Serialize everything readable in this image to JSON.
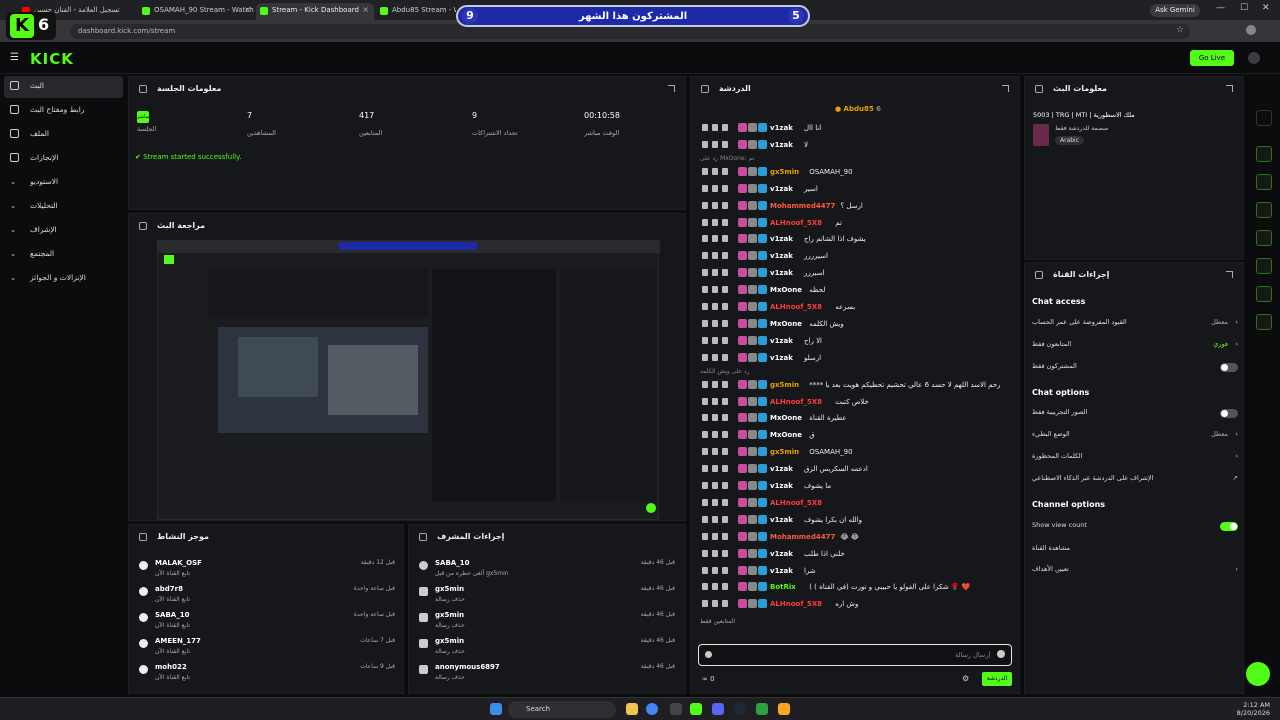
{
  "browser": {
    "tabs": [
      {
        "title": "تسجيل العلامة - الفنان حسين"
      },
      {
        "title": "OSAMAH_90 Stream - Watch Li"
      },
      {
        "title": "Stream - Kick Dashboard"
      },
      {
        "title": "Abdu85 Stream - Watch"
      }
    ],
    "url": "dashboard.kick.com/stream",
    "ask_gemini": "Ask Gemini"
  },
  "overlay": {
    "logo_number": "6",
    "sub_banner_text": "المشتركون هذا الشهر",
    "sub_left_count": "9",
    "sub_right_count": "5"
  },
  "header": {
    "logo": "KICK",
    "go_live": "Go Live"
  },
  "sidebar": {
    "items": [
      {
        "label": "البث"
      },
      {
        "label": "رابط ومفتاح البث"
      },
      {
        "label": "الملف"
      },
      {
        "label": "الإنجازات"
      },
      {
        "label": "الاستوديو"
      },
      {
        "label": "التحليلات"
      },
      {
        "label": "الإشراف"
      },
      {
        "label": "المجتمع"
      },
      {
        "label": "الإنزالات و الجوائز"
      }
    ]
  },
  "session": {
    "title": "معلومات الجلسة",
    "live_badge": "مباشر",
    "session_label": "الجلسة",
    "viewers": "7",
    "viewers_label": "المشاهدين",
    "followers": "417",
    "followers_label": "المتابعين",
    "subs": "9",
    "subs_label": "تحداد الاشتراكات",
    "uptime": "00:10:58",
    "uptime_label": "الوقت مباشر",
    "status": "Stream started successfully."
  },
  "preview": {
    "title": "مراجعة البث"
  },
  "activity": {
    "title": "موجز النشاط",
    "items": [
      {
        "name": "MALAK_OSF",
        "desc": "تابع القناة الآن",
        "time": "قبل 12 دقيقة"
      },
      {
        "name": "abd7r8",
        "desc": "تابع القناة الآن",
        "time": "قبل ساعة واحدة"
      },
      {
        "name": "SABA_10",
        "desc": "تابع القناة الآن",
        "time": "قبل ساعة واحدة"
      },
      {
        "name": "AMEEN_177",
        "desc": "تابع القناة الآن",
        "time": "قبل 7 ساعات"
      },
      {
        "name": "moh022",
        "desc": "تابع القناة الآن",
        "time": "قبل 9 ساعات"
      }
    ]
  },
  "modactions": {
    "title": "إجراءات المشرف",
    "items": [
      {
        "name": "SABA_10",
        "desc": "ألغى حظره من قبل gx5min",
        "time": "قبل 46 دقيقة"
      },
      {
        "name": "gx5min",
        "desc": "حذف رسالة",
        "time": "قبل 46 دقيقة"
      },
      {
        "name": "gx5min",
        "desc": "حذف رسالة",
        "time": "قبل 46 دقيقة"
      },
      {
        "name": "gx5min",
        "desc": "حذف رسالة",
        "time": "قبل 46 دقيقة"
      },
      {
        "name": "anonymous6897",
        "desc": "حذف رسالة",
        "time": "قبل 46 دقيقة"
      }
    ]
  },
  "chat": {
    "title": "الدردشة",
    "pinned_user": "Abdu85",
    "pinned_count": "6",
    "messages": [
      {
        "user": "v1zak",
        "color": "#ffffff",
        "text": "انا اال"
      },
      {
        "user": "v1zak",
        "color": "#ffffff",
        "text": "لا"
      },
      {
        "reply": "رد على MxOone: تم"
      },
      {
        "user": "gx5min",
        "color": "#e9a000",
        "text": "OSAMAH_90"
      },
      {
        "user": "v1zak",
        "color": "#ffffff",
        "text": "اسير"
      },
      {
        "user": "Mohammed4477",
        "color": "#ff5a3c",
        "text": "ارسل ؟"
      },
      {
        "user": "ALHnoof_5X8",
        "color": "#ff3b3b",
        "text": "تم"
      },
      {
        "user": "v1zak",
        "color": "#ffffff",
        "text": "يشوف اذا الشاتم راح"
      },
      {
        "user": "v1zak",
        "color": "#ffffff",
        "text": "اسيرررر"
      },
      {
        "user": "v1zak",
        "color": "#ffffff",
        "text": "اسيررر"
      },
      {
        "user": "MxOone",
        "color": "#ffffff",
        "text": "لحظه"
      },
      {
        "user": "ALHnoof_5X8",
        "color": "#ff3b3b",
        "text": "بسرعه"
      },
      {
        "user": "MxOone",
        "color": "#ffffff",
        "text": "ويش الكلمه"
      },
      {
        "user": "v1zak",
        "color": "#ffffff",
        "text": "الا راح"
      },
      {
        "user": "v1zak",
        "color": "#ffffff",
        "text": "ارسلو"
      },
      {
        "reply": "رد على ويش الكلمه"
      },
      {
        "user": "gx5min",
        "color": "#e9a000",
        "text": "**** رحم الاسد اللهم لا حسد 6 عالي تحشيم تحطيكم هويت بعد يا"
      },
      {
        "user": "ALHnoof_5X8",
        "color": "#ff3b3b",
        "text": "خلاص كتبت"
      },
      {
        "user": "MxOone",
        "color": "#ffffff",
        "text": "عطيرة القناة"
      },
      {
        "user": "MxOone",
        "color": "#ffffff",
        "text": "ق"
      },
      {
        "user": "gx5min",
        "color": "#e9a000",
        "text": "OSAMAH_90"
      },
      {
        "user": "v1zak",
        "color": "#ffffff",
        "text": "ادعمه السكربس الزق"
      },
      {
        "user": "v1zak",
        "color": "#ffffff",
        "text": "ما يشوف"
      },
      {
        "user": "ALHnoof_5X8",
        "color": "#ff3b3b",
        "text": ""
      },
      {
        "user": "v1zak",
        "color": "#ffffff",
        "text": "والله ان بكرا يشوف"
      },
      {
        "user": "Mohammed4477",
        "color": "#ff5a3c",
        "text": "😂 😂"
      },
      {
        "user": "v1zak",
        "color": "#ffffff",
        "text": "خلني اذا طلب"
      },
      {
        "user": "v1zak",
        "color": "#ffffff",
        "text": "شرا"
      },
      {
        "user": "BotRix",
        "color": "#53fc18",
        "text": "( شكرا على الفولو يا حبيبي و نورت (في القناة ) 🌹 ❤️"
      },
      {
        "user": "ALHnoof_5X8",
        "color": "#ff3b3b",
        "text": "وش اره"
      }
    ],
    "followers_only": "المتابعين فقط",
    "input_placeholder": "إرسال رسالة",
    "points": "0",
    "send": "الدردشة"
  },
  "stream_info": {
    "title": "معلومات البث",
    "stream_title": "5003 | TRG | MTI | ملك الاسطورية",
    "subtitle": "منصمة للدردشة فقط",
    "language": "Arabic"
  },
  "channel_actions": {
    "title": "إجراءات القناة",
    "chat_access": "Chat access",
    "access_items": [
      {
        "label": "القيود المفروضة على عمر الحساب",
        "value": "معطل"
      },
      {
        "label": "المتابعون فقط",
        "value": "فوري"
      },
      {
        "label": "المشتركون فقط",
        "value": ""
      }
    ],
    "chat_options": "Chat options",
    "chat_items": [
      {
        "label": "الصور التجريبية فقط",
        "value": ""
      },
      {
        "label": "الوضع البطيء",
        "value": "معطل"
      },
      {
        "label": "الكلمات المحظورة",
        "value": ""
      },
      {
        "label": "الإشراف على الدردشة عبر الذكاء الاصطناعي",
        "value": ""
      }
    ],
    "channel_options": "Channel options",
    "show_view_count": "Show view count",
    "share_channel": "مشاهدة القناة",
    "set_goals": "تعيين الأهداف"
  },
  "taskbar": {
    "search": "Search",
    "time": "2:12 AM",
    "date": "8/20/2026"
  },
  "colors": {
    "accent": "#53fc18",
    "panel": "#16171a",
    "bg": "#0b0c0d"
  }
}
